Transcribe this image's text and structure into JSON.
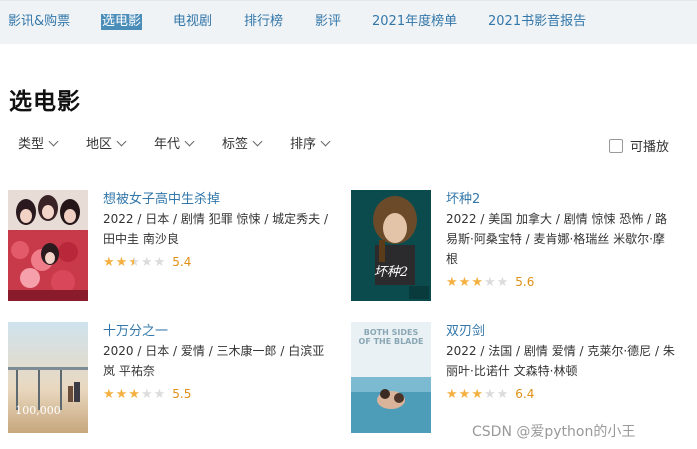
{
  "nav": {
    "items": [
      {
        "label": "影讯&购票"
      },
      {
        "label": "选电影"
      },
      {
        "label": "电视剧"
      },
      {
        "label": "排行榜"
      },
      {
        "label": "影评"
      },
      {
        "label": "2021年度榜单"
      },
      {
        "label": "2021书影音报告"
      }
    ],
    "active": "选电影"
  },
  "page_title": "选电影",
  "filters": [
    {
      "label": "类型"
    },
    {
      "label": "地区"
    },
    {
      "label": "年代"
    },
    {
      "label": "标签"
    },
    {
      "label": "排序"
    }
  ],
  "playable_label": "可播放",
  "movies": [
    {
      "title": "想被女子高中生杀掉",
      "meta_lines": [
        "2022 / 日本 / 剧情 犯罪 惊悚 / 城定秀夫 /",
        "田中圭 南沙良"
      ],
      "rating": 5.4,
      "rating_text": "5.4",
      "stars": 2.5
    },
    {
      "title": "坏种2",
      "meta_lines": [
        "2022 / 美国 加拿大 / 剧情 惊悚 恐怖 / 路",
        "易斯·阿桑宝特 / 麦肯娜·格瑞丝 米歇尔·摩",
        "根"
      ],
      "rating": 5.6,
      "rating_text": "5.6",
      "stars": 3
    },
    {
      "title": "十万分之一",
      "meta_lines": [
        "2020 / 日本 / 爱情 / 三木康一郎 / 白滨亚",
        "岚 平祐奈"
      ],
      "rating": 5.5,
      "rating_text": "5.5",
      "stars": 3
    },
    {
      "title": "双刃剑",
      "meta_lines": [
        "2022 / 法国 / 剧情 爱情 / 克莱尔·德尼 / 朱",
        "丽叶·比诺什 文森特·林顿"
      ],
      "rating": 6.4,
      "rating_text": "6.4",
      "stars": 3
    }
  ],
  "poster_texts": {
    "m2": "坏种2",
    "m3": "100,000",
    "m4": "BOTH SIDES OF THE BLADE"
  },
  "watermark": "CSDN @爱python的小王",
  "colors": {
    "link": "#3377aa",
    "nav_active_bg": "#4a8db8",
    "star": "#f4b142",
    "score": "#e09015",
    "nav_bg": "#f0f3f5"
  }
}
